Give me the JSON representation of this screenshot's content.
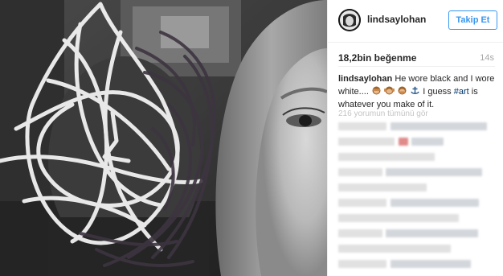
{
  "post": {
    "username": "lindsaylohan",
    "follow_label": "Takip Et",
    "likes": "18,2bin beğenme",
    "time_ago": "14s",
    "caption": {
      "user": "lindsaylohan",
      "text_part1": "He wore black and I wore white....",
      "text_part2": "I guess",
      "hashtag": "#art",
      "text_part3": "is whatever you make of it."
    },
    "view_all_comments": "216 yorumun tümünü gör"
  },
  "icons": {
    "avatar": "profile-avatar",
    "emoji": [
      "see-no-evil-monkey",
      "hear-no-evil-monkey",
      "speak-no-evil-monkey",
      "anchor"
    ]
  },
  "colors": {
    "accent": "#3897f0",
    "text": "#262626",
    "muted": "#a5a7aa",
    "hashtag": "#003569"
  }
}
